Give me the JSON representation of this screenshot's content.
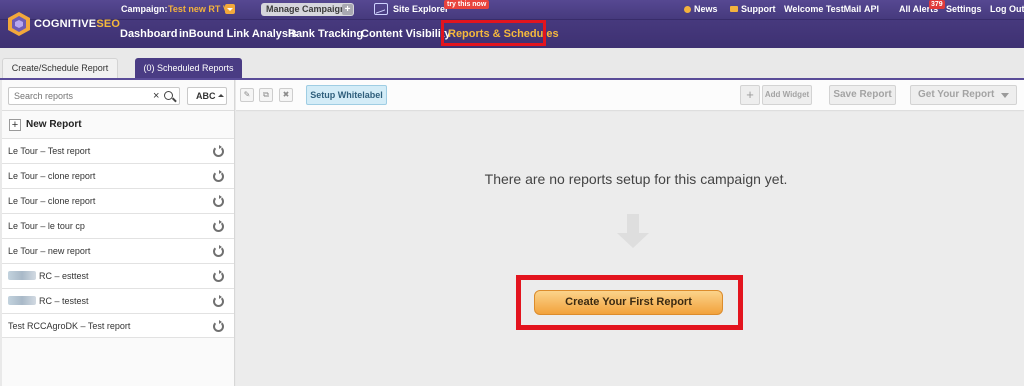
{
  "app": {
    "logo_text_a": "COGNITIVE",
    "logo_text_b": "SEO"
  },
  "topbar": {
    "campaign_label": "Campaign:",
    "campaign_value": "Test new RT V",
    "manage_campaigns": "Manage Campaigns",
    "manage_plus": "+",
    "site_explorer": "Site Explorer",
    "site_explorer_badge": "try this now",
    "news": "News",
    "support": "Support",
    "welcome": "Welcome TestMail",
    "api": "API",
    "all_alerts": "All Alerts",
    "alerts_count": "379",
    "settings": "Settings",
    "logout": "Log Out"
  },
  "nav": {
    "items": [
      "Dashboard",
      "inBound Link Analysis",
      "Rank Tracking",
      "Content Visibility",
      "Reports & Schedules"
    ]
  },
  "tabs": {
    "create_schedule": "Create/Schedule Report",
    "scheduled_reports": "(0) Scheduled Reports"
  },
  "sidebar": {
    "search_placeholder": "Search reports",
    "sort_label": "ABC",
    "new_report": "New Report",
    "reports": [
      "Le Tour – Test report",
      "Le Tour – clone report",
      "Le Tour – clone report",
      "Le Tour – le tour cp",
      "Le Tour – new report",
      "RC – esttest",
      "RC – testest",
      "Test RCCAgroDK – Test report"
    ]
  },
  "toolbar": {
    "setup_whitelabel": "Setup Whitelabel",
    "add_widget": "Add Widget",
    "save_report": "Save Report",
    "get_your_report": "Get Your Report"
  },
  "main": {
    "empty_message": "There are no reports setup for this campaign yet.",
    "create_button": "Create Your First Report"
  },
  "colors": {
    "brand_purple": "#4d3f86",
    "accent_orange": "#f3b23d",
    "highlight_red": "#e3141e",
    "whitelabel_blue": "#d3ecf7"
  }
}
